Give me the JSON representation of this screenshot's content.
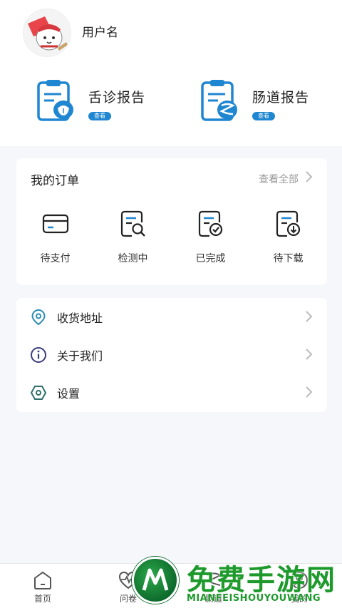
{
  "profile": {
    "username": "用户名"
  },
  "reports": [
    {
      "title": "舌诊报告",
      "badge": "查看",
      "icon": "tongue-report-icon"
    },
    {
      "title": "肠道报告",
      "badge": "查看",
      "icon": "gut-report-icon"
    }
  ],
  "orders": {
    "title": "我的订单",
    "view_all": "查看全部",
    "items": [
      {
        "label": "待支付",
        "icon": "card-icon"
      },
      {
        "label": "检测中",
        "icon": "doc-search-icon"
      },
      {
        "label": "已完成",
        "icon": "doc-check-icon"
      },
      {
        "label": "待下载",
        "icon": "doc-download-icon"
      }
    ]
  },
  "menu": [
    {
      "label": "收货地址",
      "icon": "location-icon"
    },
    {
      "label": "关于我们",
      "icon": "info-icon"
    },
    {
      "label": "设置",
      "icon": "settings-icon"
    }
  ],
  "tabbar": [
    {
      "label": "首页",
      "icon": "home-icon"
    },
    {
      "label": "问卷",
      "icon": "heartbeat-icon"
    },
    {
      "label": "肠道",
      "icon": "gut-icon"
    },
    {
      "label": "我的",
      "icon": "profile-icon"
    }
  ],
  "watermark": {
    "title": "免费手游网",
    "subtitle": "MIANFEISHOUYOUWANG"
  },
  "colors": {
    "accent": "#1f86d1",
    "background": "#f6f7fb",
    "watermark": "#1e9a2d"
  }
}
